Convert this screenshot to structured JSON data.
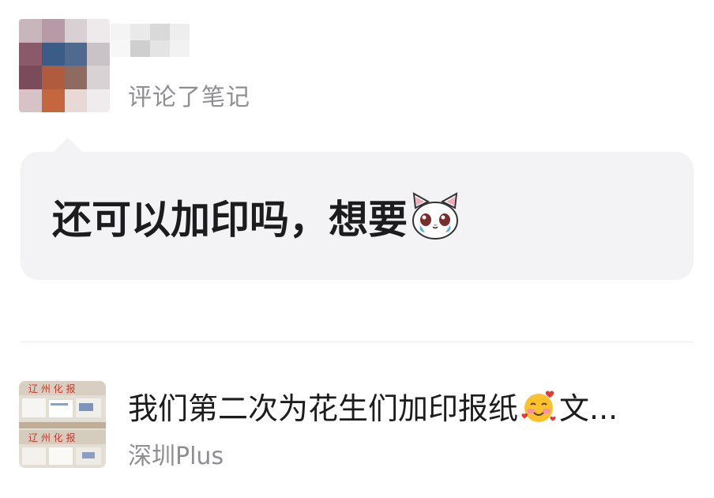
{
  "header": {
    "action_text": "评论了笔记"
  },
  "comment": {
    "text": "还可以加印吗，想要",
    "emoji_icon": "crying-cat-icon"
  },
  "note": {
    "title_before": "我们第二次为花生们加印报纸",
    "title_emoji": "smiling-face-with-hearts-icon",
    "title_after": "文...",
    "subtitle": "深圳Plus"
  },
  "colors": {
    "bubble_bg": "#f3f3f6",
    "secondary_text": "#8e8e93",
    "primary_text": "#1c1c1e"
  }
}
